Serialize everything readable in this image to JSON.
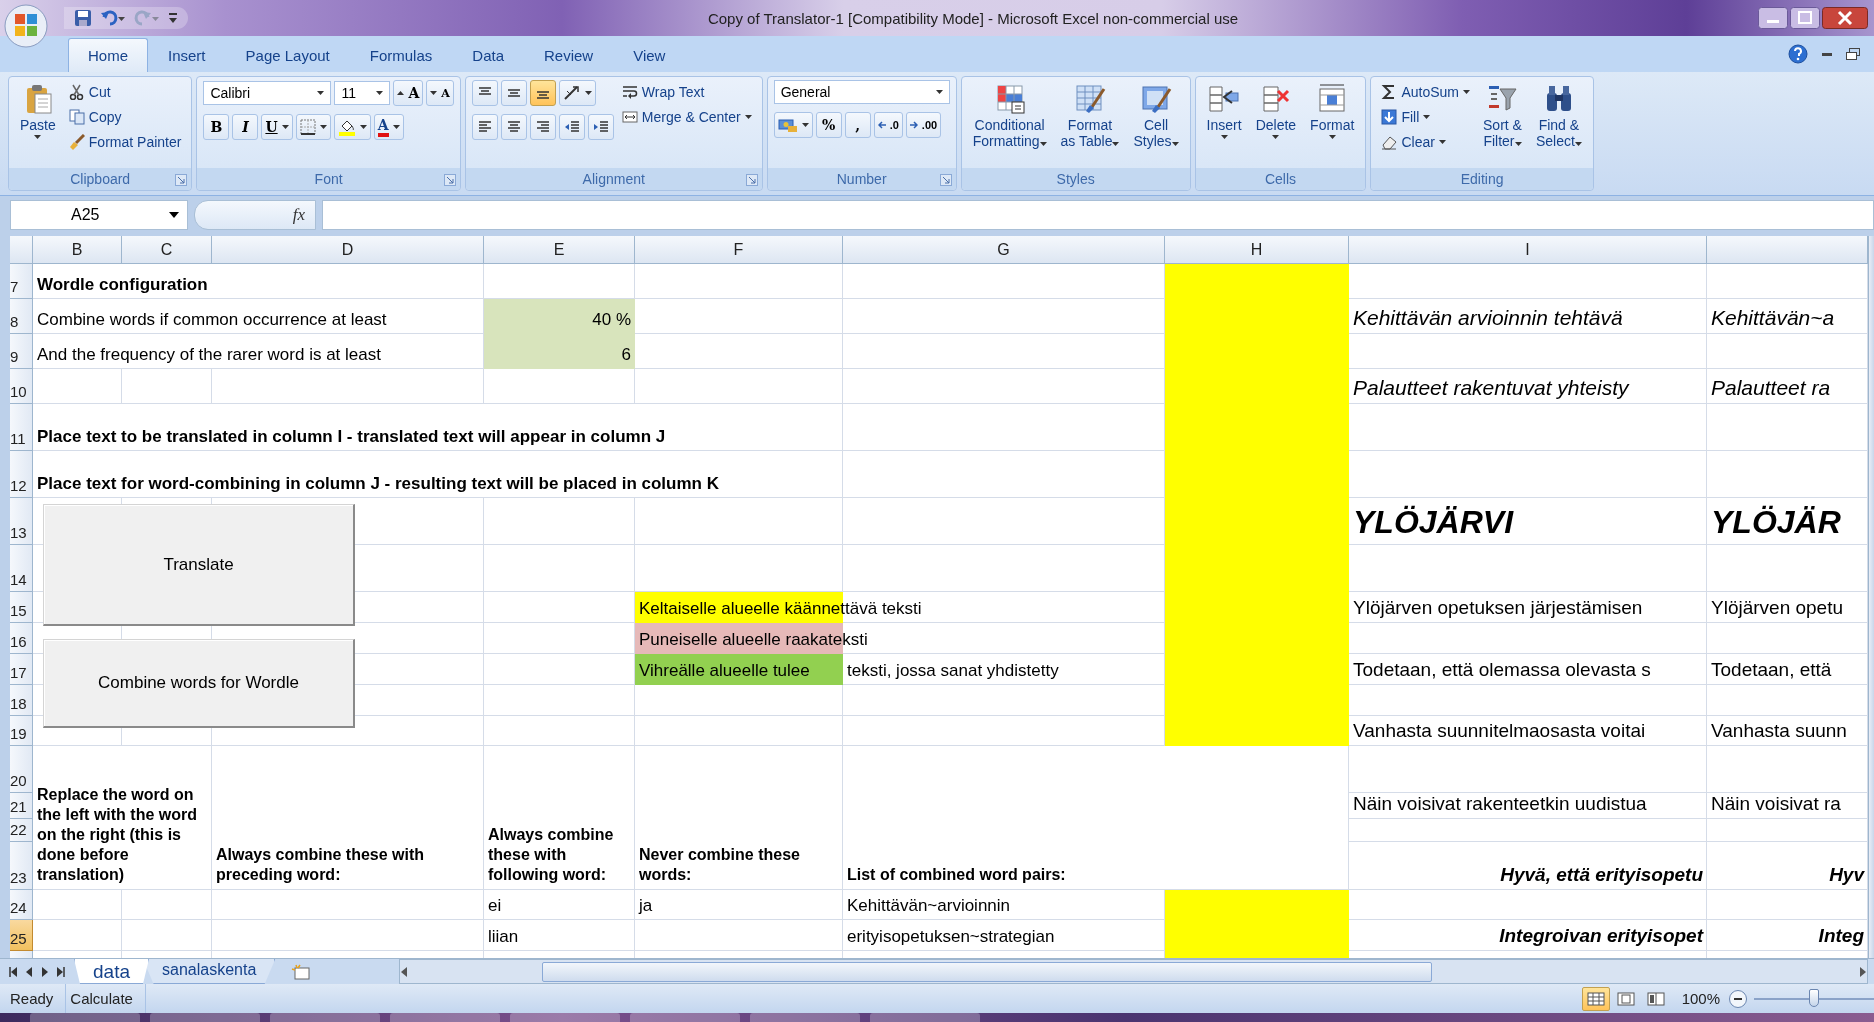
{
  "window": {
    "title": "Copy of Translator-1  [Compatibility Mode] - Microsoft Excel non-commercial use"
  },
  "ribbon_tabs": [
    {
      "label": "Home",
      "selected": true
    },
    {
      "label": "Insert",
      "selected": false
    },
    {
      "label": "Page Layout",
      "selected": false
    },
    {
      "label": "Formulas",
      "selected": false
    },
    {
      "label": "Data",
      "selected": false
    },
    {
      "label": "Review",
      "selected": false
    },
    {
      "label": "View",
      "selected": false
    }
  ],
  "ribbon_groups": [
    {
      "label": "Clipboard",
      "launcher": true,
      "items": [
        {
          "kind": "tall",
          "label": "Paste",
          "dropdown": true
        },
        {
          "kind": "stack",
          "items": [
            {
              "label": "Cut",
              "dropdown": false
            },
            {
              "label": "Copy",
              "dropdown": false
            },
            {
              "label": "Format Painter",
              "dropdown": false
            }
          ]
        }
      ]
    },
    {
      "label": "Font",
      "launcher": true,
      "items": [
        {
          "kind": "font-tools",
          "font": "Calibri",
          "size": "11",
          "grow": "A",
          "shrink": "A",
          "bold": "B",
          "italic": "I",
          "underline": "U",
          "font_color": "A"
        }
      ]
    },
    {
      "label": "Alignment",
      "launcher": true,
      "items": [
        {
          "kind": "align-tools",
          "vertical": [
            {
              "selected": false
            },
            {
              "selected": false
            },
            {
              "selected": true
            }
          ]
        },
        {
          "kind": "stack",
          "items": [
            {
              "label": "Wrap Text",
              "dropdown": false
            },
            {
              "label": "Merge & Center",
              "dropdown": true
            }
          ]
        }
      ]
    },
    {
      "label": "Number",
      "launcher": true,
      "items": [
        {
          "kind": "number-tools",
          "format": "General",
          "percent": "%",
          "comma": ",",
          "increase_decimal": ".0",
          "decrease_decimal": ".00"
        }
      ]
    },
    {
      "label": "Styles",
      "launcher": false,
      "items": [
        {
          "kind": "large",
          "label": "Conditional\nFormatting",
          "dropdown": true
        },
        {
          "kind": "large",
          "label": "Format\nas Table",
          "dropdown": true
        },
        {
          "kind": "large",
          "label": "Cell\nStyles",
          "dropdown": true
        }
      ]
    },
    {
      "label": "Cells",
      "launcher": false,
      "items": [
        {
          "kind": "tall",
          "label": "Insert",
          "dropdown": true
        },
        {
          "kind": "tall",
          "label": "Delete",
          "dropdown": true
        },
        {
          "kind": "tall",
          "label": "Format",
          "dropdown": true
        }
      ]
    },
    {
      "label": "Editing",
      "launcher": false,
      "items": [
        {
          "kind": "stack",
          "items": [
            {
              "label": "AutoSum",
              "dropdown": true
            },
            {
              "label": "Fill",
              "dropdown": true
            },
            {
              "label": "Clear",
              "dropdown": true
            }
          ]
        },
        {
          "kind": "large",
          "label": "Sort &\nFilter",
          "dropdown": true
        },
        {
          "kind": "large",
          "label": "Find &\nSelect",
          "dropdown": true
        }
      ]
    }
  ],
  "formula_bar": {
    "name_box": "A25",
    "function_label": "fx"
  },
  "sheet": {
    "columns": [
      {
        "label": "B"
      },
      {
        "label": "C"
      },
      {
        "label": "D"
      },
      {
        "label": "E"
      },
      {
        "label": "F"
      },
      {
        "label": "G"
      },
      {
        "label": "H",
        "color": "#ffff00"
      },
      {
        "label": "I"
      }
    ],
    "rows": [
      {
        "number": "7",
        "selected": false,
        "cells": {
          "B": {
            "text": "Wordle configuration",
            "kind": "bold"
          }
        }
      },
      {
        "number": "8",
        "selected": false,
        "cells": {
          "B": {
            "text": "Combine words if common occurrence at least",
            "kind": "plain"
          },
          "E": {
            "text": "40 %",
            "kind": "number",
            "color": "#d8e4bc"
          },
          "I": {
            "text": "Kehittävän arvioinnin tehtävä",
            "kind": "large-italic"
          },
          "J": {
            "text": "Kehittävän~a",
            "kind": "large-italic"
          }
        }
      },
      {
        "number": "9",
        "selected": false,
        "cells": {
          "B": {
            "text": "And the frequency of the rarer word is at least",
            "kind": "plain"
          },
          "E": {
            "text": "6",
            "kind": "number",
            "color": "#d8e4bc"
          }
        }
      },
      {
        "number": "10",
        "selected": false,
        "cells": {
          "I": {
            "text": "Palautteet rakentuvat yhteisty",
            "kind": "large-italic"
          },
          "J": {
            "text": "Palautteet ra",
            "kind": "large-italic"
          }
        }
      },
      {
        "number": "11",
        "selected": false,
        "cells": {
          "B": {
            "text": "Place text to be translated in column I - translated text will appear in column J",
            "kind": "bold"
          }
        }
      },
      {
        "number": "12",
        "selected": false,
        "cells": {
          "B": {
            "text": "Place text for word-combining in column J - resulting text will be placed in column K",
            "kind": "bold"
          }
        }
      },
      {
        "number": "13",
        "selected": false,
        "cells": {
          "I": {
            "text": "YLÖJÄRVI",
            "kind": "title"
          },
          "J": {
            "text": "YLÖJÄR",
            "kind": "title"
          }
        }
      },
      {
        "number": "14",
        "selected": false,
        "cells": {}
      },
      {
        "number": "15",
        "selected": false,
        "cells": {
          "F": {
            "text": "Keltaiselle alueelle käännettävä teksti",
            "kind": "plain",
            "color": "#ffff00"
          },
          "I": {
            "text": "Ylöjärven opetuksen järjestämisen",
            "kind": "large"
          },
          "J": {
            "text": "Ylöjärven opetu",
            "kind": "large"
          }
        }
      },
      {
        "number": "16",
        "selected": false,
        "cells": {
          "F": {
            "text": "Puneiselle alueelle raakateksti",
            "kind": "plain",
            "color": "#e6b9b8"
          }
        }
      },
      {
        "number": "17",
        "selected": false,
        "cells": {
          "F": {
            "text": "Vihreälle alueelle tulee",
            "kind": "plain",
            "color": "#92d050"
          },
          "G": {
            "text": "teksti, jossa sanat yhdistetty",
            "kind": "plain"
          },
          "I": {
            "text": "Todetaan, että olemassa olevasta s",
            "kind": "large"
          },
          "J": {
            "text": "Todetaan, että",
            "kind": "large"
          }
        }
      },
      {
        "number": "18",
        "selected": false,
        "cells": {}
      },
      {
        "number": "19",
        "selected": false,
        "cells": {
          "I": {
            "text": "Vanhasta suunnitelmaosasta voitai",
            "kind": "large"
          },
          "J": {
            "text": "Vanhasta suunn",
            "kind": "large"
          }
        }
      },
      {
        "number": "20",
        "selected": false,
        "cells": {}
      },
      {
        "number": "21",
        "selected": false,
        "cells": {
          "I": {
            "text": "Näin voisivat rakenteetkin uudistua",
            "kind": "large"
          },
          "J": {
            "text": "Näin voisivat ra",
            "kind": "large"
          }
        }
      },
      {
        "number": "22",
        "selected": false,
        "cells": {}
      },
      {
        "number": "23",
        "selected": false,
        "cells": {
          "B": {
            "text": "Replace the word on the left with the word on the right (this is done before translation)",
            "kind": "wrap-header"
          },
          "D": {
            "text": "Always combine these with preceding word:",
            "kind": "wrap-header"
          },
          "E": {
            "text": "Always combine these with following word:",
            "kind": "wrap-header"
          },
          "F": {
            "text": "Never combine these words:",
            "kind": "wrap-header"
          },
          "G": {
            "text": "List of combined word pairs:",
            "kind": "wrap-header"
          },
          "I": {
            "text": "Hyvä, että erityisopetu",
            "kind": "large-bold-italic-right"
          },
          "J": {
            "text": "Hyv",
            "kind": "large-bold-italic-right"
          }
        }
      },
      {
        "number": "24",
        "selected": false,
        "cells": {
          "E": {
            "text": "ei",
            "kind": "plain"
          },
          "F": {
            "text": "ja",
            "kind": "plain"
          },
          "G": {
            "text": "Kehittävän~arvioinnin",
            "kind": "plain"
          }
        }
      },
      {
        "number": "25",
        "selected": true,
        "cells": {
          "E": {
            "text": "liian",
            "kind": "plain"
          },
          "G": {
            "text": "erityisopetuksen~strategian",
            "kind": "plain"
          },
          "I": {
            "text": "Integroivan erityisopet",
            "kind": "large-bold-italic-right"
          },
          "J": {
            "text": "Integ",
            "kind": "large-bold-italic-right"
          }
        }
      }
    ],
    "form_buttons": [
      {
        "label": "Translate"
      },
      {
        "label": "Combine words for Wordle"
      }
    ]
  },
  "sheet_tabs": [
    {
      "label": "data",
      "selected": true
    },
    {
      "label": "sanalaskenta",
      "selected": false
    }
  ],
  "status_bar": {
    "items": [
      "Ready",
      "Calculate"
    ],
    "views": [
      {
        "selected": true
      },
      {
        "selected": false
      },
      {
        "selected": false
      }
    ],
    "zoom": "100%",
    "zoom_slider": {
      "level": 0.5
    }
  }
}
